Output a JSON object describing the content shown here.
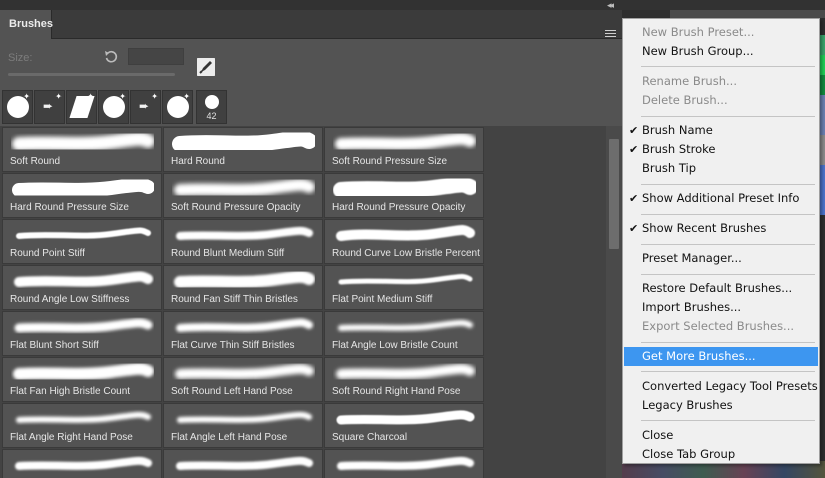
{
  "panel": {
    "tab_label": "Brushes",
    "size_label": "Size:",
    "size_value": ""
  },
  "recent_brushes": [
    {
      "icon": "round-brush",
      "count": ""
    },
    {
      "icon": "arrow-brush",
      "count": ""
    },
    {
      "icon": "parallelogram-brush",
      "count": ""
    },
    {
      "icon": "round-brush",
      "count": ""
    },
    {
      "icon": "arrow-brush",
      "count": ""
    },
    {
      "icon": "round-brush",
      "count": ""
    },
    {
      "icon": "small-round-brush",
      "count": "42"
    }
  ],
  "brushes": [
    "Soft Round",
    "Hard Round",
    "Soft Round Pressure Size",
    "Hard Round Pressure Size",
    "Soft Round Pressure Opacity",
    "Hard Round Pressure Opacity",
    "Round Point Stiff",
    "Round Blunt Medium Stiff",
    "Round Curve Low Bristle Percent",
    "Round Angle Low Stiffness",
    "Round Fan Stiff Thin Bristles",
    "Flat Point Medium Stiff",
    "Flat Blunt Short Stiff",
    "Flat Curve Thin Stiff Bristles",
    "Flat Angle Low Bristle Count",
    "Flat Fan High Bristle Count",
    "Soft Round Left Hand Pose",
    "Soft Round Right Hand Pose",
    "Flat Angle Right Hand Pose",
    "Flat Angle Left Hand Pose",
    "Square Charcoal",
    "",
    "",
    ""
  ],
  "menu": {
    "items": [
      {
        "label": "New Brush Preset...",
        "disabled": true,
        "checked": false
      },
      {
        "label": "New Brush Group...",
        "disabled": false,
        "checked": false
      },
      {
        "label": "Rename Brush...",
        "disabled": true,
        "checked": false
      },
      {
        "label": "Delete Brush...",
        "disabled": true,
        "checked": false
      },
      {
        "label": "Brush Name",
        "disabled": false,
        "checked": true
      },
      {
        "label": "Brush Stroke",
        "disabled": false,
        "checked": true
      },
      {
        "label": "Brush Tip",
        "disabled": false,
        "checked": false
      },
      {
        "label": "Show Additional Preset Info",
        "disabled": false,
        "checked": true
      },
      {
        "label": "Show Recent Brushes",
        "disabled": false,
        "checked": true
      },
      {
        "label": "Preset Manager...",
        "disabled": false,
        "checked": false
      },
      {
        "label": "Restore Default Brushes...",
        "disabled": false,
        "checked": false
      },
      {
        "label": "Import Brushes...",
        "disabled": false,
        "checked": false
      },
      {
        "label": "Export Selected Brushes...",
        "disabled": true,
        "checked": false
      },
      {
        "label": "Get More Brushes...",
        "disabled": false,
        "checked": false,
        "highlighted": true
      },
      {
        "label": "Converted Legacy Tool Presets",
        "disabled": false,
        "checked": false
      },
      {
        "label": "Legacy Brushes",
        "disabled": false,
        "checked": false
      },
      {
        "label": "Close",
        "disabled": false,
        "checked": false
      },
      {
        "label": "Close Tab Group",
        "disabled": false,
        "checked": false
      }
    ]
  },
  "colors": {
    "panel_bg": "#535353",
    "menu_bg": "#f0f0f0",
    "menu_highlight": "#3d96f0"
  }
}
